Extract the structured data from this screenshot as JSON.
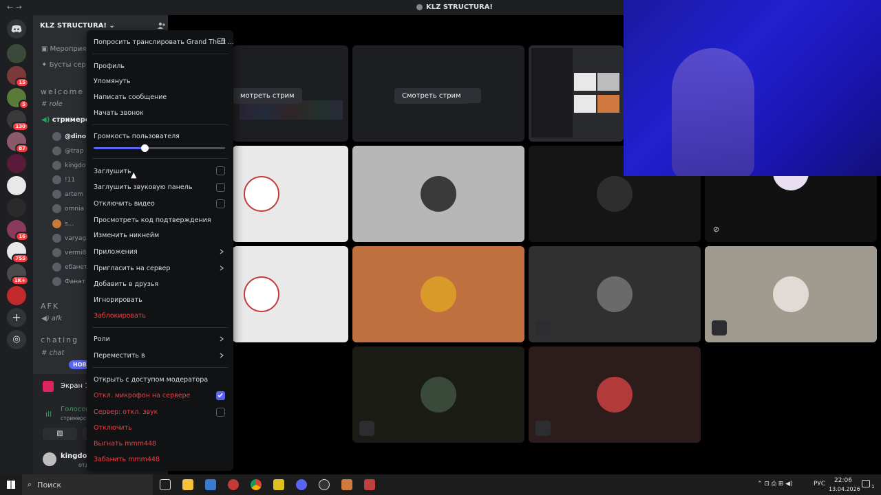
{
  "window": {
    "title": "KLZ STRUCTURA!"
  },
  "server": {
    "name": "KLZ STRUCTURA!"
  },
  "channels": {
    "events": "Мероприя",
    "boosts": "Бусты сер",
    "cat_welcome": "welcome",
    "role": "role",
    "streamers": "стримерск",
    "cat_afk": "AFK",
    "afk": "afk",
    "cat_chat": "chating",
    "chat": "chat",
    "new_badge": "НОВЫ"
  },
  "voice_users": [
    "@dino",
    "@trap",
    "kingdo",
    "!11",
    "artem",
    "omnia",
    "s...",
    "varyag",
    "vermi8",
    "ебанет",
    "Фанат"
  ],
  "guild_badges": [
    "15",
    "5",
    "130",
    "87",
    "16",
    "755",
    "1K+"
  ],
  "screenshare": {
    "label": "Экран 1"
  },
  "voice": {
    "status": "Голосовая связь п",
    "channel": "стримерская / klz structura!"
  },
  "user": {
    "name": "kingdomcasualas...",
    "status": "отдыхаю"
  },
  "stage": {
    "watch_label": "Смотреть стрим",
    "watch_label_cut": "мотреть стрим"
  },
  "menu": {
    "top": "Попросить транслировать Grand Theft ...",
    "profile": "Профиль",
    "mention": "Упомянуть",
    "message": "Написать сообщение",
    "call": "Начать звонок",
    "volume": "Громкость пользователя",
    "volume_value": 0.39,
    "mute": "Заглушить",
    "mute_soundboard": "Заглушить звуковую панель",
    "disable_video": "Отключить видео",
    "verify_code": "Просмотреть код подтверждения",
    "nickname": "Изменить никнейм",
    "apps": "Приложения",
    "invite": "Пригласить на сервер",
    "add_friend": "Добавить в друзья",
    "ignore": "Игнорировать",
    "block": "Заблокировать",
    "roles": "Роли",
    "move": "Переместить в",
    "mod_view": "Открыть с доступом модератора",
    "server_mute": "Откл. микрофон на сервере",
    "server_deafen": "Сервер: откл. звук",
    "disconnect": "Отключить",
    "kick": "Выгнать mmm448",
    "ban": "Забанить mmm448"
  },
  "taskbar": {
    "search": "Поиск",
    "lang": "РУС",
    "time": "22:06",
    "date": "13.04.2026",
    "notif": "1"
  },
  "colors": {
    "accent": "#5865f2",
    "danger": "#f23f43",
    "online": "#23a55a"
  }
}
